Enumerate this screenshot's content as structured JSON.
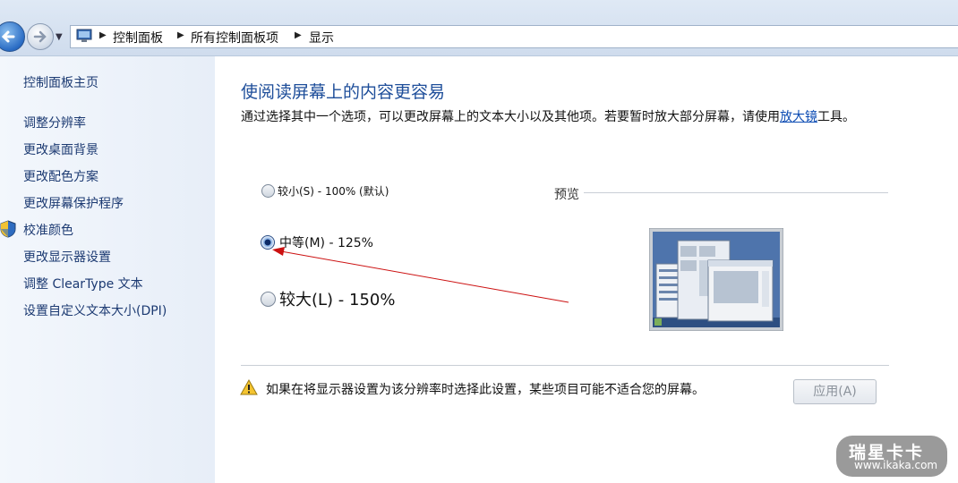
{
  "addressbar": {
    "breadcrumbs": [
      "控制面板",
      "所有控制面板项",
      "显示"
    ]
  },
  "sidebar": {
    "items": [
      {
        "label": "控制面板主页"
      },
      {
        "label": "调整分辨率"
      },
      {
        "label": "更改桌面背景"
      },
      {
        "label": "更改配色方案"
      },
      {
        "label": "更改屏幕保护程序"
      },
      {
        "label": "校准颜色"
      },
      {
        "label": "更改显示器设置"
      },
      {
        "label": "调整 ClearType 文本"
      },
      {
        "label": "设置自定义文本大小(DPI)"
      }
    ]
  },
  "main": {
    "title": "使阅读屏幕上的内容更容易",
    "description_before": "通过选择其中一个选项，可以更改屏幕上的文本大小以及其他项。若要暂时放大部分屏幕，请使用",
    "description_link": "放大镜",
    "description_after": "工具。",
    "options": [
      {
        "label": "较小(S) - 100% (默认)",
        "selected": false
      },
      {
        "label": "中等(M) - 125%",
        "selected": true
      },
      {
        "label": "较大(L) - 150%",
        "selected": false
      }
    ],
    "preview_label": "预览",
    "warning_text": "如果在将显示器设置为该分辨率时选择此设置，某些项目可能不适合您的屏幕。",
    "apply_label": "应用(A)"
  },
  "watermark": {
    "brand": "瑞星卡卡",
    "url": "www.ikaka.com"
  },
  "colors": {
    "title": "#1e4e9a",
    "link": "#1c3a72",
    "annotation_arrow": "#cc1111"
  }
}
